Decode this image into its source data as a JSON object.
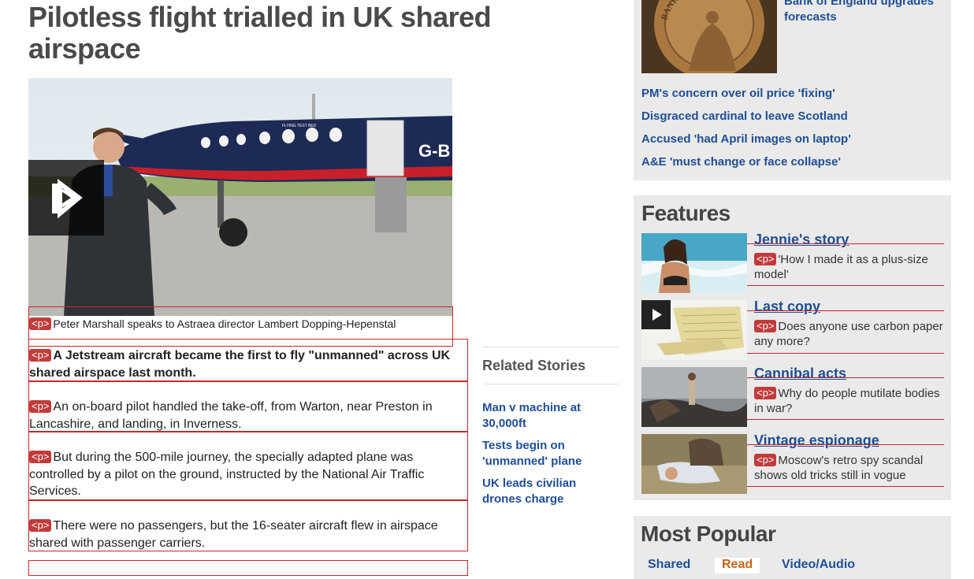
{
  "article": {
    "headline": "Pilotless flight trialled in UK shared airspace",
    "caption_tag": "<p>",
    "caption": "Peter Marshall speaks to Astraea director Lambert Dopping-Hepenstal",
    "paragraphs": [
      {
        "tag": "<p>",
        "text": "A Jetstream aircraft became the first to fly \"unmanned\" across UK shared airspace last month."
      },
      {
        "tag": "<p>",
        "text": "An on-board pilot handled the take-off, from Warton, near Preston in Lancashire, and landing, in Inverness."
      },
      {
        "tag": "<p>",
        "text": "But during the 500-mile journey, the specially adapted plane was controlled by a pilot on the ground, instructed by the National Air Traffic Services."
      },
      {
        "tag": "<p>",
        "text": "There were no passengers, but the 16-seater aircraft flew in airspace shared with passenger carriers."
      }
    ],
    "video_plane_label": "FLYING TEST BED",
    "video_plane_reg": "G-B"
  },
  "related": {
    "title": "Related Stories",
    "links": [
      "Man v machine at 30,000ft",
      "Tests begin on 'unmanned' plane",
      "UK leads civilian drones charge"
    ]
  },
  "news": {
    "top_link": "Bank of England upgrades forecasts",
    "coin_text": "BANK OF ENGLAND",
    "links": [
      "PM's concern over oil price 'fixing'",
      "Disgraced cardinal to leave Scotland",
      "Accused 'had April images on laptop'",
      "A&E 'must change or face collapse'"
    ]
  },
  "features": {
    "title": "Features",
    "items": [
      {
        "title": "Jennie's story",
        "tag": "<p>",
        "text": "'How I made it as a plus-size model'"
      },
      {
        "title": "Last copy",
        "tag": "<p>",
        "text": "Does anyone use carbon paper any more?"
      },
      {
        "title": "Cannibal acts",
        "tag": "<p>",
        "text": "Why do people mutilate bodies in war?"
      },
      {
        "title": "Vintage espionage",
        "tag": "<p>",
        "text": "Moscow's retro spy scandal shows old tricks still in vogue"
      }
    ]
  },
  "most_popular": {
    "title": "Most Popular",
    "tabs": [
      "Shared",
      "Read",
      "Video/Audio"
    ]
  },
  "colors": {
    "link": "#1f4e96",
    "tag": "#c23b3b",
    "outline": "#c62828",
    "panel": "#eaeaea"
  }
}
